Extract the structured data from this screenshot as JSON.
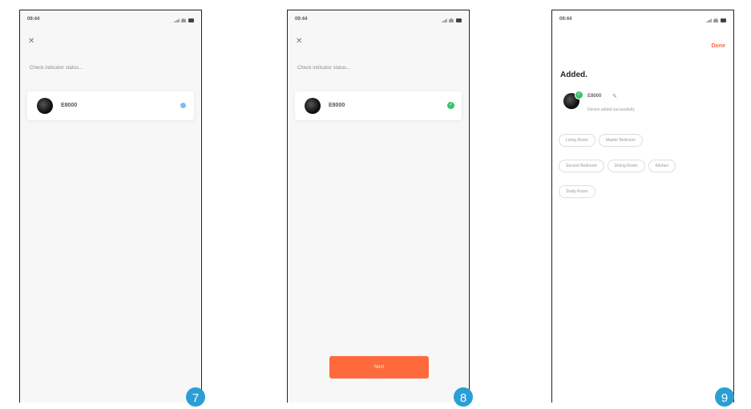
{
  "status_bar": {
    "time": "09:44"
  },
  "panels": [
    {
      "message": "Check indicator status...",
      "device": {
        "name": "E8000"
      },
      "step": "7"
    },
    {
      "message": "Check indicator status...",
      "device": {
        "name": "E8000"
      },
      "next_button": "Next",
      "step": "8"
    },
    {
      "done": "Done",
      "title": "Added.",
      "device": {
        "name": "E8000",
        "status": "Device added successfully"
      },
      "rooms": [
        "Living Room",
        "Master Bedroom",
        "Second Bedroom",
        "Dining Room",
        "Kitchen",
        "Study Room"
      ],
      "step": "9"
    }
  ],
  "colors": {
    "accent": "#ff6a3d",
    "success": "#35c46a",
    "step_badge": "#2a9fd6"
  },
  "icons": {
    "close": "close-icon",
    "edit": "pencil-icon",
    "check": "check-icon"
  }
}
